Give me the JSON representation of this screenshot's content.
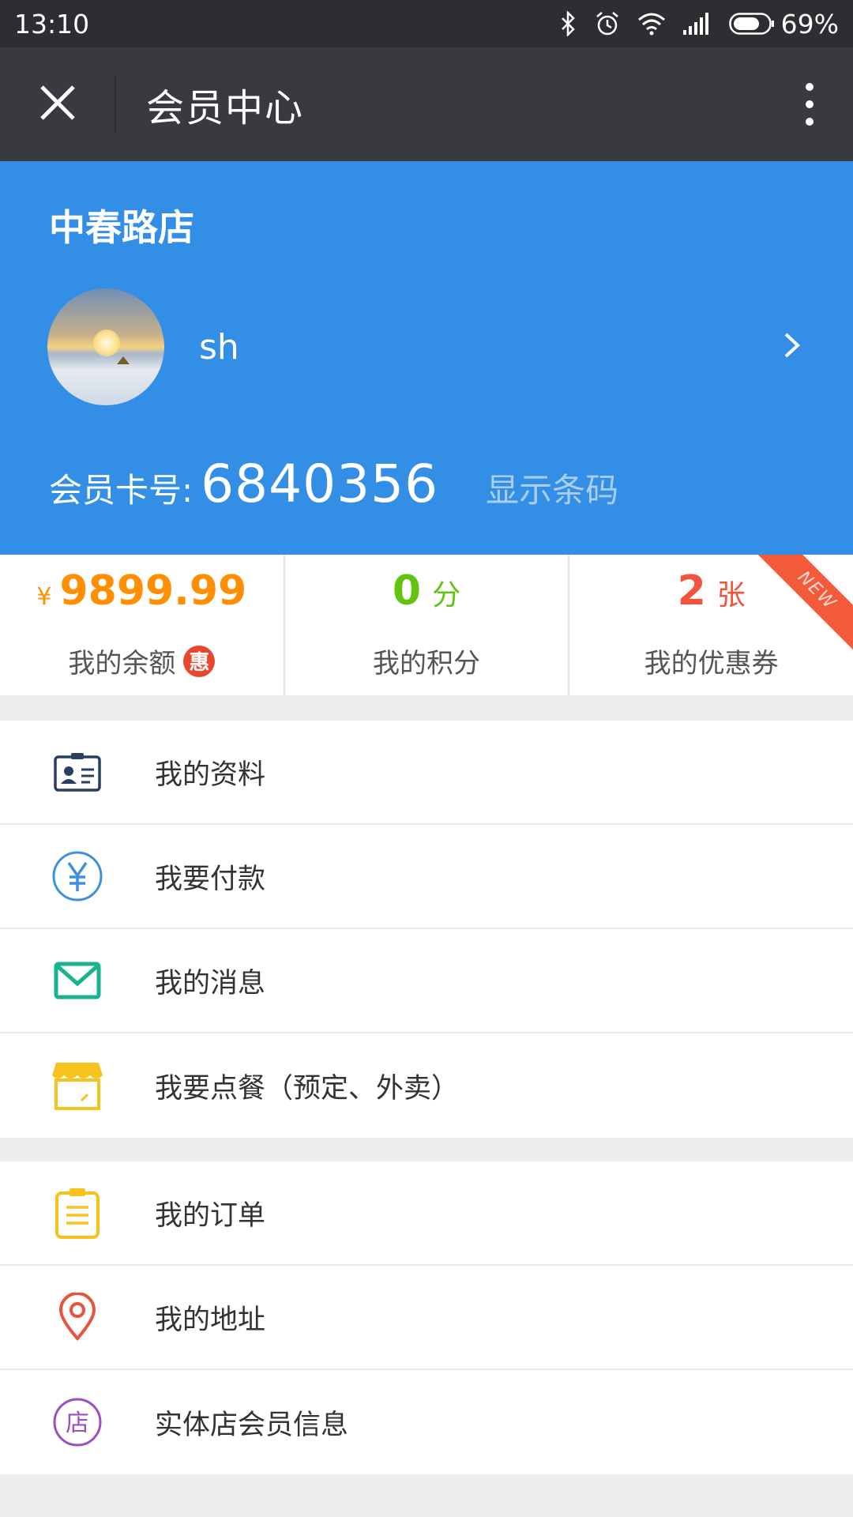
{
  "status_bar": {
    "time": "13:10",
    "battery": "69%",
    "icons": [
      "bluetooth-icon",
      "alarm-icon",
      "wifi-icon",
      "signal-icon",
      "battery-icon"
    ]
  },
  "app_bar": {
    "title": "会员中心",
    "close_icon": "close-icon",
    "more_icon": "more-vertical-icon"
  },
  "header": {
    "store_name": "中春路店",
    "username": "sh",
    "card_label": "会员卡号:",
    "card_number": "6840356",
    "show_barcode": "显示条码",
    "background_color": "#338fe6"
  },
  "stats": {
    "balance": {
      "currency": "¥",
      "value": "9899.99",
      "label": "我的余额",
      "badge": "惠"
    },
    "points": {
      "value": "0",
      "unit": "分",
      "label": "我的积分"
    },
    "coupons": {
      "value": "2",
      "unit": "张",
      "label": "我的优惠券",
      "ribbon": "NEW"
    }
  },
  "menu_group_1": [
    {
      "label": "我的资料",
      "icon": "id-card-icon"
    },
    {
      "label": "我要付款",
      "icon": "yen-circle-icon"
    },
    {
      "label": "我的消息",
      "icon": "envelope-icon"
    },
    {
      "label": "我要点餐（预定、外卖）",
      "icon": "storefront-icon"
    }
  ],
  "menu_group_2": [
    {
      "label": "我的订单",
      "icon": "clipboard-icon"
    },
    {
      "label": "我的地址",
      "icon": "location-pin-icon"
    },
    {
      "label": "实体店会员信息",
      "icon": "store-badge-icon",
      "icon_text": "店"
    }
  ]
}
